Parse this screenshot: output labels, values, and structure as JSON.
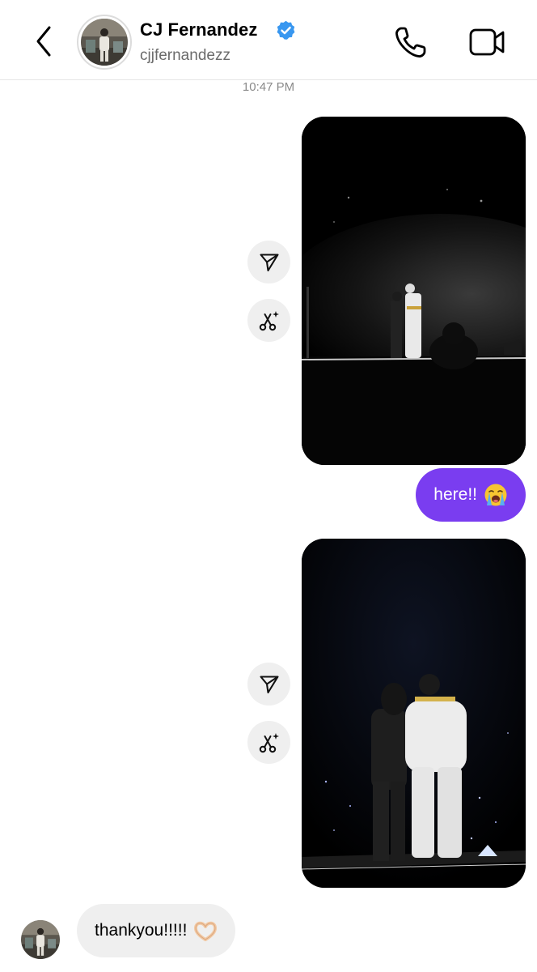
{
  "header": {
    "name": "CJ Fernandez",
    "handle": "cjjfernandezz",
    "verified": true,
    "back_icon": "chevron-left-icon",
    "call_icon": "phone-icon",
    "video_icon": "video-camera-icon"
  },
  "thread": {
    "timestamp": "10:47 PM",
    "messages": [
      {
        "type": "media",
        "direction": "outgoing",
        "content": "concert-stage-photo"
      },
      {
        "type": "text",
        "direction": "outgoing",
        "text": "here!!",
        "emoji": "loudly-crying-face"
      },
      {
        "type": "media",
        "direction": "outgoing",
        "content": "concert-stage-photo"
      },
      {
        "type": "text",
        "direction": "incoming",
        "text": "thankyou!!!!!",
        "emoji": "heart-hands"
      }
    ],
    "media_actions": [
      "share-icon",
      "ai-edit-icon"
    ]
  },
  "colors": {
    "outgoing_bubble": "#7a3df0",
    "incoming_bubble": "#efefef",
    "verified_badge": "#3897f0",
    "timestamp": "#8a8a8a"
  }
}
